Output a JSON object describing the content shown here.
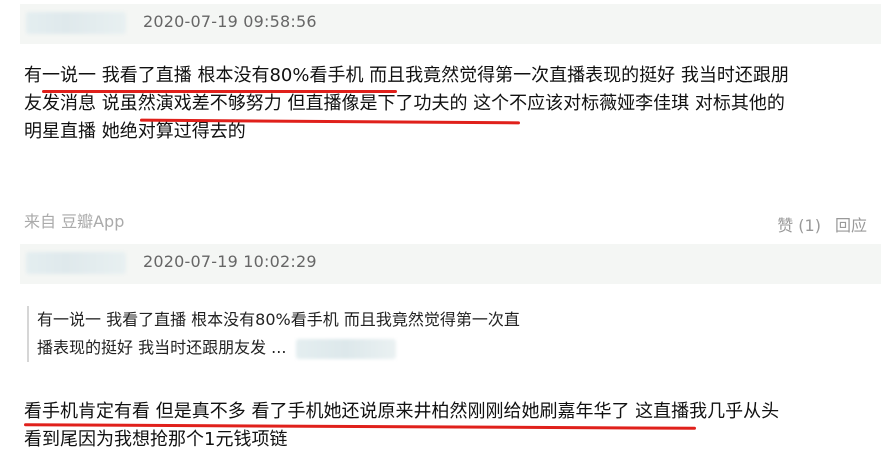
{
  "comments": [
    {
      "timestamp": "2020-07-19 09:58:56",
      "lines": [
        "有一说一 我看了直播 根本没有80%看手机 而且我竟然觉得第一次直播表现的挺好 我当时还跟朋",
        "友发消息 说虽然演戏差不够努力 但直播像是下了功夫的 这个不应该对标薇娅李佳琪 对标其他的",
        "明星直播 她绝对算过得去的"
      ],
      "source": "来自 豆瓣App",
      "like_label": "赞 (1)",
      "reply_label": "回应"
    },
    {
      "timestamp": "2020-07-19 10:02:29",
      "quote_lines": [
        "有一说一 我看了直播 根本没有80%看手机 而且我竟然觉得第一次直",
        "播表现的挺好 我当时还跟朋友发 ..."
      ],
      "lines": [
        "看手机肯定有看 但是真不多 看了手机她还说原来井柏然刚刚给她刷嘉年华了 这直播我几乎从头",
        "看到尾因为我想抢那个1元钱项链"
      ]
    }
  ],
  "colors": {
    "underline": "#e0201b",
    "header_bg": "#f4f6f4",
    "timestamp": "#666666",
    "muted": "#999999"
  }
}
